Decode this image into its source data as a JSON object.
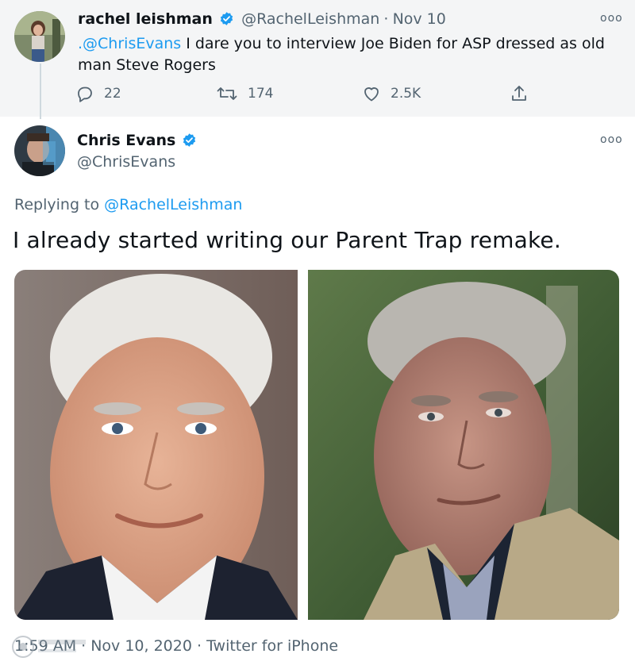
{
  "parent_tweet": {
    "display_name": "rachel leishman",
    "handle": "@RachelLeishman",
    "separator": "·",
    "date": "Nov 10",
    "mention": ".@ChrisEvans",
    "text_line1": " I dare you to interview Joe Biden for ASP dressed as old",
    "text_line2": "man Steve Rogers",
    "more_label": "ooo",
    "actions": {
      "reply_count": "22",
      "retweet_count": "174",
      "like_count": "2.5K"
    }
  },
  "main_tweet": {
    "display_name": "Chris Evans",
    "handle": "@ChrisEvans",
    "more_label": "ooo",
    "replying_prefix": "Replying to ",
    "replying_to": "@RachelLeishman",
    "text": "I already started writing our Parent Trap remake.",
    "footer": "1:59 AM · Nov 10, 2020 · Twitter for iPhone"
  },
  "colors": {
    "accent": "#1d9bf0",
    "secondary_text": "#536471",
    "parent_bg": "#f4f5f6"
  },
  "icons": [
    "verified-badge-icon",
    "more-options-icon",
    "reply-icon",
    "retweet-icon",
    "like-icon",
    "share-icon"
  ]
}
